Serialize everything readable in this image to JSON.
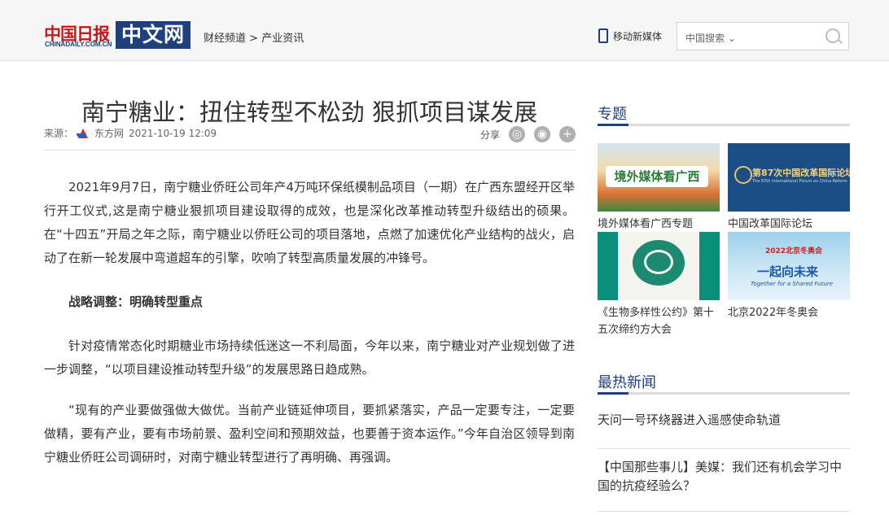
{
  "header": {
    "logo_cn": "中国日报",
    "logo_en": "CHINADAILY.COM.CN",
    "logo_zw": "中文网",
    "breadcrumb_1": "财经频道",
    "breadcrumb_sep": ">",
    "breadcrumb_2": "产业资讯",
    "mobile_label": "移动新媒体",
    "search_select": "中国搜索 ⌄"
  },
  "article": {
    "title": "南宁糖业：扭住转型不松劲 狠抓项目谋发展",
    "source_label": "来源：",
    "source_name": "东方网",
    "datetime": "2021-10-19 12:09",
    "share_label": "分享",
    "p1": "2021年9月7日，南宁糖业侨旺公司年产4万吨环保纸模制品项目（一期）在广西东盟经开区举行开工仪式,这是南宁糖业狠抓项目建设取得的成效，也是深化改革推动转型升级结出的硕果。在“十四五”开局之年之际，南宁糖业以侨旺公司的项目落地，点燃了加速优化产业结构的战火，启动了在新一轮发展中弯道超车的引擎，吹响了转型高质量发展的冲锋号。",
    "subhead": "战略调整：明确转型重点",
    "p2": "针对疫情常态化时期糖业市场持续低迷这一不利局面，今年以来，南宁糖业对产业规划做了进一步调整，“以项目建设推动转型升级”的发展思路日趋成熟。",
    "p3": "“现有的产业要做强做大做优。当前产业链延伸项目，要抓紧落实，产品一定要专注，一定要做精，要有产业，要有市场前景、盈利空间和预期效益，也要善于资本运作。”今年自治区领导到南宁糖业侨旺公司调研时，对南宁糖业转型进行了再明确、再强调。"
  },
  "sidebar": {
    "topics_title": "专题",
    "topics": [
      {
        "caption": "境外媒体看广西专题",
        "img_text": "境外媒体看广西"
      },
      {
        "caption": "中国改革国际论坛",
        "img_text": "第87次中国改革国际论坛",
        "img_sub": "The 87th International Forum on China Reform"
      },
      {
        "caption": "《生物多样性公约》第十五次缔约方大会"
      },
      {
        "caption": "北京2022年冬奥会",
        "img_text": "一起向未来",
        "img_sub": "Together for a Shared Future",
        "img_logo": "2022北京冬奥会"
      }
    ],
    "hot_title": "最热新闻",
    "hot": [
      "天问一号环绕器进入遥感使命轨道",
      "【中国那些事儿】美媒：我们还有机会学习中国的抗疫经验么？"
    ]
  },
  "colors": {
    "brand_blue": "#1f3f7e",
    "brand_red": "#c8161d"
  }
}
